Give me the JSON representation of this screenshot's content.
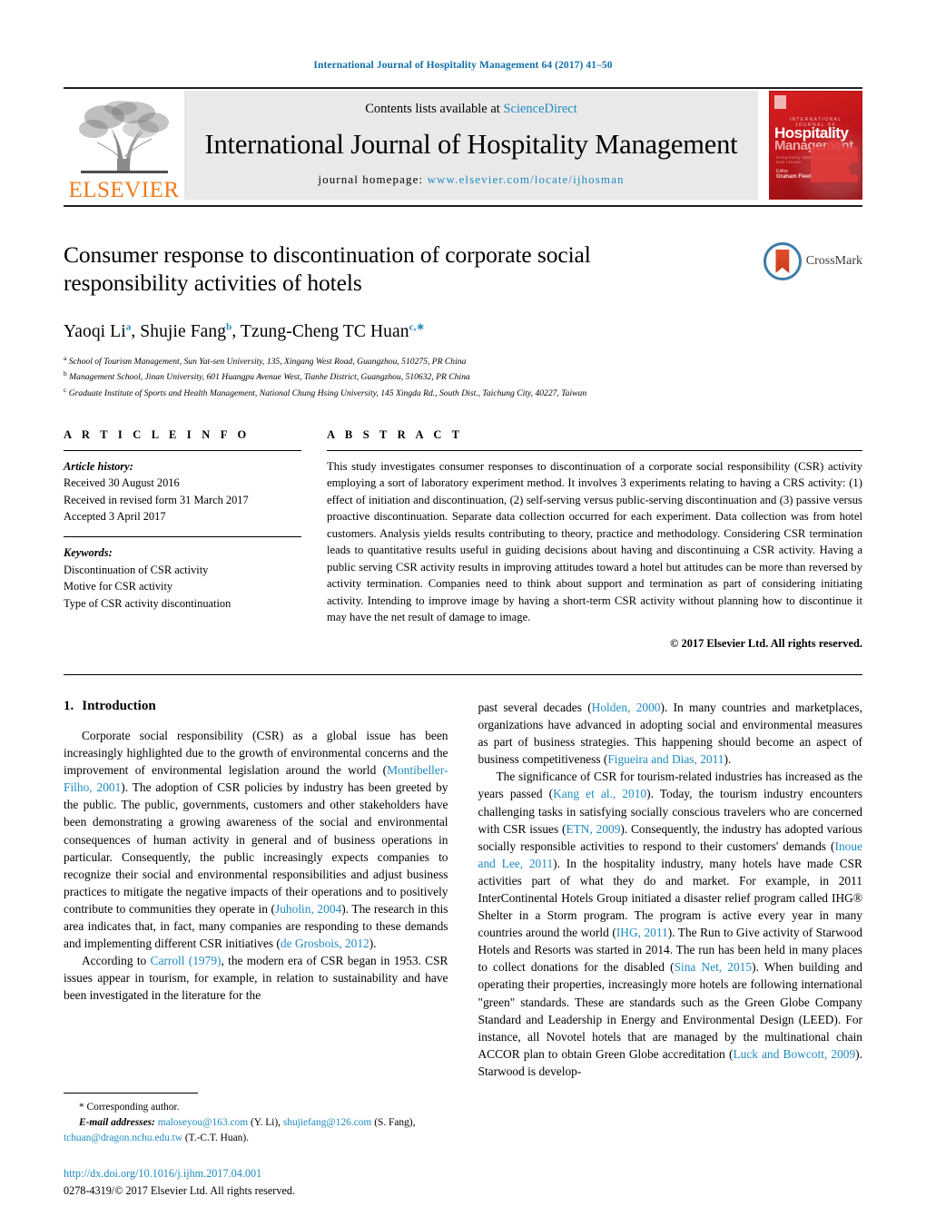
{
  "running_head": "International Journal of Hospitality Management 64 (2017) 41–50",
  "masthead": {
    "publisher": "ELSEVIER",
    "contents_prefix": "Contents lists available at ",
    "contents_link": "ScienceDirect",
    "journal_title": "International Journal of Hospitality Management",
    "homepage_prefix": "journal homepage: ",
    "homepage_url": "www.elsevier.com/locate/ijhosman",
    "cover": {
      "kicker": "INTERNATIONAL JOURNAL OF",
      "line1": "Hospitality",
      "line2": "Management",
      "subline": "Hospitality Management Trends and Issues",
      "editor_label": "Editor",
      "editor_name": "Graham Fleet"
    }
  },
  "article": {
    "title": "Consumer response to discontinuation of corporate social responsibility activities of hotels",
    "crossmark_label": "CrossMark",
    "authors": [
      {
        "name": "Yaoqi Li",
        "sup": "a"
      },
      {
        "name": "Shujie Fang",
        "sup": "b"
      },
      {
        "name": "Tzung-Cheng TC Huan",
        "sup": "c,∗"
      }
    ],
    "authors_line": "Yaoqi Li a , Shujie Fang b , Tzung-Cheng TC Huan c,*",
    "affiliations": [
      {
        "marker": "a",
        "text": "School of Tourism Management, Sun Yat-sen University, 135, Xingang West Road, Guangzhou, 510275, PR China"
      },
      {
        "marker": "b",
        "text": "Management School, Jinan University, 601 Huangpu Avenue West, Tianhe District, Guangzhou, 510632, PR China"
      },
      {
        "marker": "c",
        "text": "Graduate Institute of Sports and Health Management, National Chung Hsing University, 145 Xingda Rd., South Dist., Taichung City, 40227, Taiwan"
      }
    ]
  },
  "article_info": {
    "heading": "A R T I C L E   I N F O",
    "history_label": "Article history:",
    "history": [
      "Received 30 August 2016",
      "Received in revised form 31 March 2017",
      "Accepted 3 April 2017"
    ],
    "keywords_label": "Keywords:",
    "keywords": [
      "Discontinuation of CSR activity",
      "Motive for CSR activity",
      "Type of CSR activity discontinuation"
    ]
  },
  "abstract": {
    "heading": "A B S T R A C T",
    "text": "This study investigates consumer responses to discontinuation of a corporate social responsibility (CSR) activity employing a sort of laboratory experiment method. It involves 3 experiments relating to having a CRS activity: (1) effect of initiation and discontinuation, (2) self-serving versus public-serving discontinuation and (3) passive versus proactive discontinuation. Separate data collection occurred for each experiment. Data collection was from hotel customers. Analysis yields results contributing to theory, practice and methodology. Considering CSR termination leads to quantitative results useful in guiding decisions about having and discontinuing a CSR activity. Having a public serving CSR activity results in improving attitudes toward a hotel but attitudes can be more than reversed by activity termination. Companies need to think about support and termination as part of considering initiating activity. Intending to improve image by having a short-term CSR activity without planning how to discontinue it may have the net result of damage to image.",
    "copyright": "© 2017 Elsevier Ltd. All rights reserved."
  },
  "introduction": {
    "number": "1.",
    "heading": "Introduction",
    "left_p1_a": "Corporate social responsibility (CSR) as a global issue has been increasingly highlighted due to the growth of environmental concerns and the improvement of environmental legislation around the world (",
    "left_p1_cite1": "Montibeller-Filho, 2001",
    "left_p1_b": "). The adoption of CSR policies by industry has been greeted by the public. The public, governments, customers and other stakeholders have been demonstrating a growing awareness of the social and environmental consequences of human activity in general and of business operations in particular. Consequently, the public increasingly expects companies to recognize their social and environmental responsibilities and adjust business practices to mitigate the negative impacts of their operations and to positively contribute to communities they operate in (",
    "left_p1_cite2": "Juholin, 2004",
    "left_p1_c": "). The research in this area indicates that, in fact, many companies are responding to these demands and implementing different CSR initiatives (",
    "left_p1_cite3": "de Grosbois, 2012",
    "left_p1_d": ").",
    "left_p2_a": "According to ",
    "left_p2_cite1": "Carroll (1979)",
    "left_p2_b": ", the modern era of CSR began in 1953. CSR issues appear in tourism, for example, in relation to sustainability and have been investigated in the literature for the",
    "right_p1_a": "past several decades (",
    "right_p1_cite1": "Holden, 2000",
    "right_p1_b": "). In many countries and marketplaces, organizations have advanced in adopting social and environmental measures as part of business strategies. This happening should become an aspect of business competitiveness (",
    "right_p1_cite2": "Figueira and Dias, 2011",
    "right_p1_c": ").",
    "right_p2_a": "The significance of CSR for tourism-related industries has increased as the years passed (",
    "right_p2_cite1": "Kang et al., 2010",
    "right_p2_b": "). Today, the tourism industry encounters challenging tasks in satisfying socially conscious travelers who are concerned with CSR issues (",
    "right_p2_cite2": "ETN, 2009",
    "right_p2_c": "). Consequently, the industry has adopted various socially responsible activities to respond to their customers' demands (",
    "right_p2_cite3": "Inoue and Lee, 2011",
    "right_p2_d": "). In the hospitality industry, many hotels have made CSR activities part of what they do and market. For example, in 2011 InterContinental Hotels Group initiated a disaster relief program called IHG® Shelter in a Storm program. The program is active every year in many countries around the world (",
    "right_p2_cite4": "IHG, 2011",
    "right_p2_e": "). The Run to Give activity of Starwood Hotels and Resorts was started in 2014. The run has been held in many places to collect donations for the disabled (",
    "right_p2_cite5": "Sina Net, 2015",
    "right_p2_f": "). When building and operating their properties, increasingly more hotels are following international \"green\" standards. These are standards such as the Green Globe Company Standard and Leadership in Energy and Environmental Design (LEED). For instance, all Novotel hotels that are managed by the multinational chain ACCOR plan to obtain Green Globe accreditation (",
    "right_p2_cite6": "Luck and Bowcott, 2009",
    "right_p2_g": "). Starwood is develop-"
  },
  "footnotes": {
    "corresponding": "* Corresponding author.",
    "email_label": "E-mail addresses:",
    "email1": "maloseyou@163.com",
    "email1_owner": "(Y. Li),",
    "email2": "shujiefang@126.com",
    "email2_owner": "(S. Fang),",
    "email3": "tchuan@dragon.nchu.edu.tw",
    "email3_owner": "(T.-C.T. Huan)."
  },
  "doi": {
    "url": "http://dx.doi.org/10.1016/j.ijhm.2017.04.001",
    "issn": "0278-4319/© 2017 Elsevier Ltd. All rights reserved."
  },
  "colors": {
    "link": "#1f8ac0",
    "elsevier_orange": "#f2791b",
    "cover_red": "#c51b1b",
    "masthead_bg": "#e9e9e9"
  }
}
